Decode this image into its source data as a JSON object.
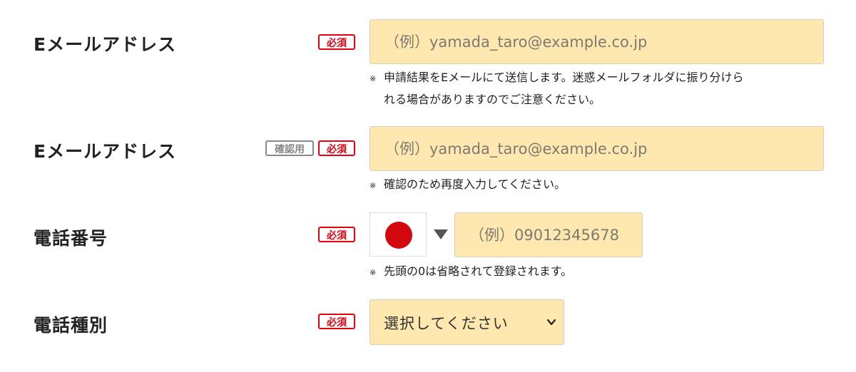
{
  "fields": {
    "email": {
      "label": "Eメールアドレス",
      "required_badge": "必須",
      "placeholder": "（例）yamada_taro@example.co.jp",
      "note_mark": "※",
      "note_line1": "申請結果をEメールにて送信します。迷惑メールフォルダに振り分けら",
      "note_line2": "れる場合がありますのでご注意ください。"
    },
    "email_confirm": {
      "label": "Eメールアドレス",
      "confirm_badge": "確認用",
      "required_badge": "必須",
      "placeholder": "（例）yamada_taro@example.co.jp",
      "note_mark": "※",
      "note": "確認のため再度入力してください。"
    },
    "phone": {
      "label": "電話番号",
      "required_badge": "必須",
      "country_flag": "japan-flag",
      "placeholder": "（例）09012345678",
      "note_mark": "※",
      "note": "先頭の0は省略されて登録されます。"
    },
    "phone_type": {
      "label": "電話種別",
      "required_badge": "必須",
      "selected_value": "選択してください"
    }
  },
  "colors": {
    "input_bg": "#fee8b0",
    "required_red": "#e60012",
    "confirm_gray": "#888888",
    "flag_red": "#d20a0f"
  }
}
